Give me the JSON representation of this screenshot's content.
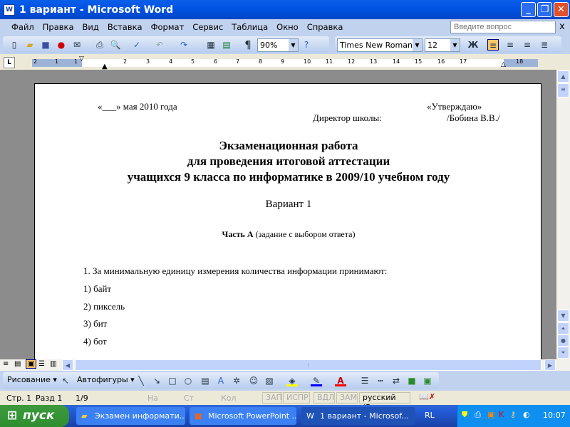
{
  "window": {
    "title": "1 вариант - Microsoft Word"
  },
  "menu": {
    "items": [
      "Файл",
      "Правка",
      "Вид",
      "Вставка",
      "Формат",
      "Сервис",
      "Таблица",
      "Окно",
      "Справка"
    ],
    "ask_placeholder": "Введите вопрос",
    "close_label": "x"
  },
  "toolbar": {
    "zoom": "90%",
    "font": "Times New Roman",
    "size": "12",
    "bold_label": "Ж",
    "pilcrow": "¶",
    "accent": "#f9c66b"
  },
  "ruler": {
    "numbers": [
      "2",
      "1",
      "1",
      "2",
      "3",
      "4",
      "5",
      "6",
      "7",
      "8",
      "9",
      "10",
      "11",
      "12",
      "13",
      "14",
      "15",
      "16",
      "17",
      "18"
    ],
    "tab_label": "L"
  },
  "document": {
    "date_line": "«___» мая 2010 года",
    "approve": "«Утверждаю»",
    "director": "Директор школы:",
    "director_name": "/Бобина В.В./",
    "title_lines": [
      "Экзаменационная работа",
      "для проведения итоговой аттестации",
      "учащихся 9 класса по информатике в 2009/10 учебном году"
    ],
    "variant": "Вариант 1",
    "part_bold": "Часть А",
    "part_rest": " (задание с выбором ответа)",
    "question": "1. За минимальную единицу измерения количества информации принимают:",
    "options": [
      "1)  байт",
      "2)  пиксель",
      "3)  бит",
      "4)  бот"
    ]
  },
  "drawing": {
    "draw_label": "Рисование",
    "autoshapes_label": "Автофигуры",
    "fill_color": "#ffff00",
    "line_color": "#0000ff",
    "font_color": "#ff0000"
  },
  "status": {
    "page": "Стр. 1",
    "section": "Разд  1",
    "pages": "1/9",
    "at": "На",
    "line": "Ст",
    "col": "Кол",
    "rec": "ЗАП",
    "trk": "ИСПР",
    "ext": "ВДЛ",
    "ovr": "ЗАМ",
    "lang": "русский (Ро"
  },
  "taskbar": {
    "start": "пуск",
    "tasks": [
      "Экзамен информати...",
      "Microsoft PowerPoint ...",
      "1 вариант - Microsof..."
    ],
    "lang": "RL",
    "clock": "10:07"
  }
}
